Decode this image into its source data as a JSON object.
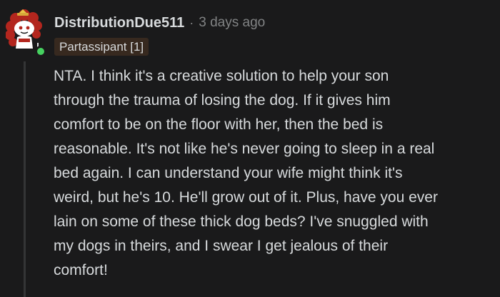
{
  "comment": {
    "author": "DistributionDue511",
    "separator": "·",
    "timestamp": "3 days ago",
    "flair": "Partassipant [1]",
    "body": "NTA. I think it's a creative solution to help your son\nthrough the trauma of losing the dog. If it gives him\ncomfort to be on the floor with her, then the bed is\nreasonable. It's not like he's never going to sleep in a real\nbed again. I can understand your wife might think it's\nweird, but he's 10. He'll grow out of it. Plus, have you ever\nlain on some of these thick dog beds? I've snuggled with\nmy dogs in theirs, and I swear I get jealous of their\ncomfort!"
  },
  "colors": {
    "background": "#1a1a1b",
    "text": "#d7dadc",
    "meta": "#818384",
    "flair_bg": "#37291f",
    "online": "#46d160",
    "avatar_hair": "#b3261e"
  },
  "icons": {
    "avatar": "reddit-snoo-avatar",
    "status": "online-status-icon"
  }
}
